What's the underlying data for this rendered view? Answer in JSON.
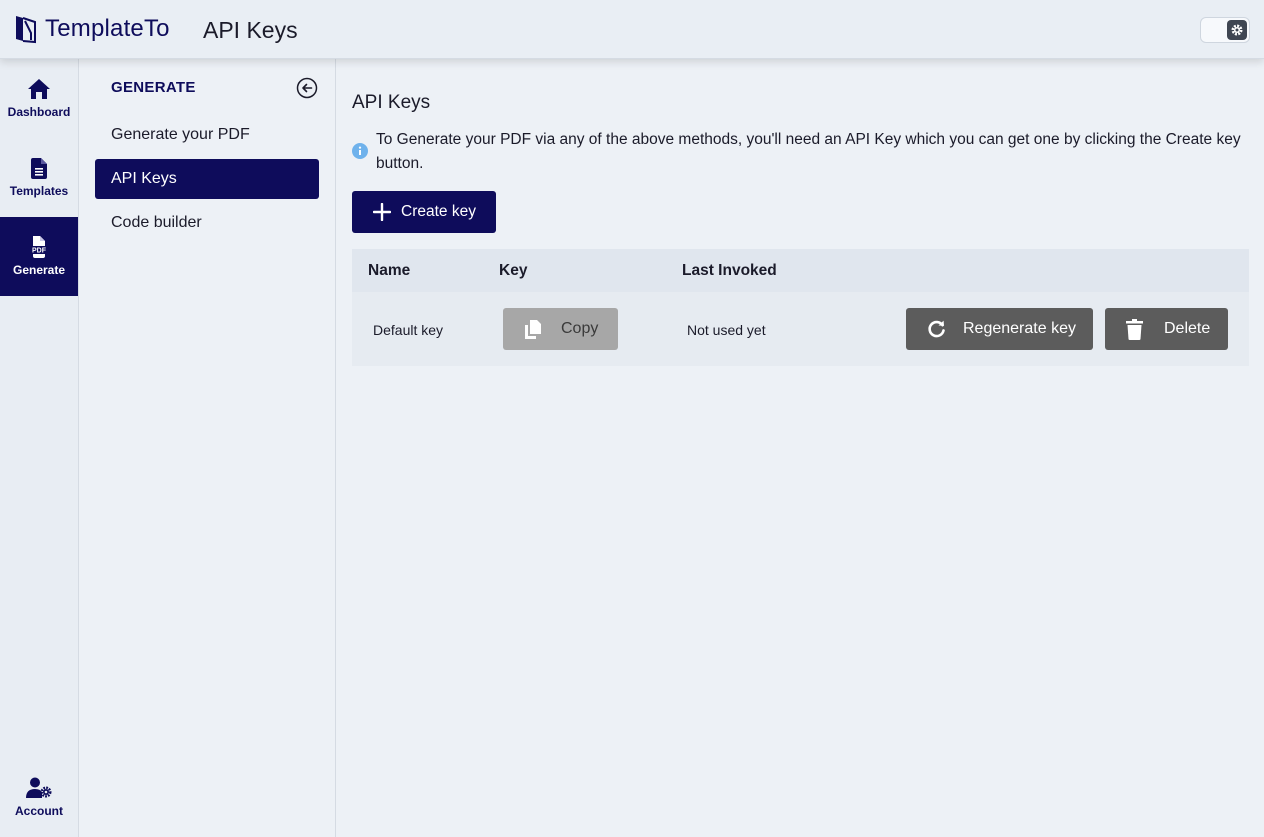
{
  "header": {
    "brand_name": "TemplateTo",
    "page_title": "API Keys"
  },
  "rail": {
    "items": [
      {
        "label": "Dashboard",
        "icon": "home-icon",
        "active": false
      },
      {
        "label": "Templates",
        "icon": "document-icon",
        "active": false
      },
      {
        "label": "Generate",
        "icon": "pdf-icon",
        "active": true
      }
    ],
    "account": {
      "label": "Account",
      "icon": "user-settings-icon"
    }
  },
  "subnav": {
    "title": "GENERATE",
    "items": [
      {
        "label": "Generate your PDF",
        "active": false
      },
      {
        "label": "API Keys",
        "active": true
      },
      {
        "label": "Code builder",
        "active": false
      }
    ]
  },
  "main": {
    "title": "API Keys",
    "info": "To Generate your PDF via any of the above methods, you'll need an API Key which you can get one by clicking the Create key button.",
    "create_button": "Create key",
    "table": {
      "columns": [
        "Name",
        "Key",
        "Last Invoked"
      ],
      "rows": [
        {
          "name": "Default key",
          "copy_label": "Copy",
          "last_invoked": "Not used yet",
          "regenerate_label": "Regenerate key",
          "delete_label": "Delete"
        }
      ]
    }
  },
  "colors": {
    "brand": "#0e0c5b",
    "background": "#edf1f6",
    "copy_button": "#a7a7a7",
    "action_button": "#5c5c5c",
    "info": "#6fb2ec"
  }
}
